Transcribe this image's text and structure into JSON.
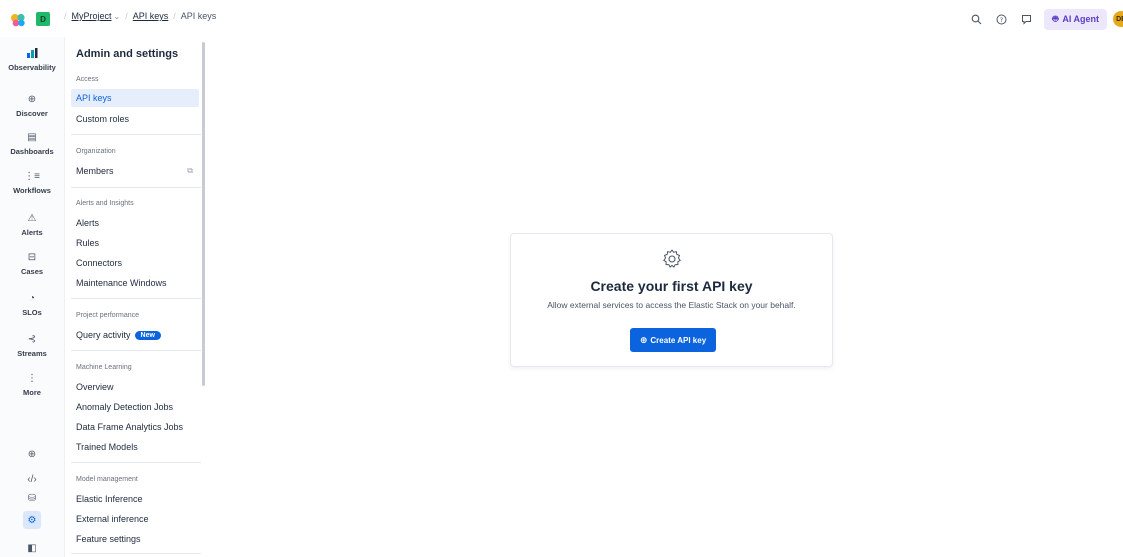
{
  "topbar": {
    "space_initial": "D",
    "breadcrumbs": [
      "MyProject",
      "API keys",
      "API keys"
    ],
    "ai_agent_label": "AI Agent",
    "avatar_initials": "DE",
    "icons": [
      "search-icon",
      "help-icon",
      "feedback-icon",
      "robot-icon"
    ]
  },
  "leftnav": {
    "items": [
      {
        "label": "Observability",
        "icon": "chart-icon"
      },
      {
        "label": "Discover",
        "icon": "compass-icon"
      },
      {
        "label": "Dashboards",
        "icon": "dashboard-icon"
      },
      {
        "label": "Workflows",
        "icon": "workflow-icon"
      },
      {
        "label": "Alerts",
        "icon": "warning-icon"
      },
      {
        "label": "Cases",
        "icon": "briefcase-icon"
      },
      {
        "label": "SLOs",
        "icon": "gauge-icon"
      },
      {
        "label": "Streams",
        "icon": "streams-icon"
      },
      {
        "label": "More",
        "icon": "more-icon"
      }
    ]
  },
  "panel": {
    "title": "Admin and settings",
    "sections": {
      "access": "Access",
      "organization": "Organization",
      "alerts": "Alerts and Insights",
      "performance": "Project performance",
      "ml": "Machine Learning",
      "model": "Model management"
    },
    "items": {
      "api_keys": "API keys",
      "custom_roles": "Custom roles",
      "members": "Members",
      "alerts": "Alerts",
      "rules": "Rules",
      "connectors": "Connectors",
      "maintenance": "Maintenance Windows",
      "query_activity": "Query activity",
      "new_badge": "New",
      "overview": "Overview",
      "anomaly": "Anomaly Detection Jobs",
      "dfa": "Data Frame Analytics Jobs",
      "trained": "Trained Models",
      "elastic_inference": "Elastic Inference",
      "external_inference": "External inference",
      "feature_settings": "Feature settings"
    }
  },
  "main": {
    "empty_title": "Create your first API key",
    "empty_body": "Allow external services to access the Elastic Stack on your behalf.",
    "create_button": "Create API key"
  },
  "colors": {
    "primary": "#0b64dd",
    "active_bg": "#e6eefb",
    "ai_agent_bg": "#ece7fb",
    "ai_agent_text": "#5a3dc4",
    "avatar": "#e7a81a",
    "space_badge": "#1fb86a"
  }
}
